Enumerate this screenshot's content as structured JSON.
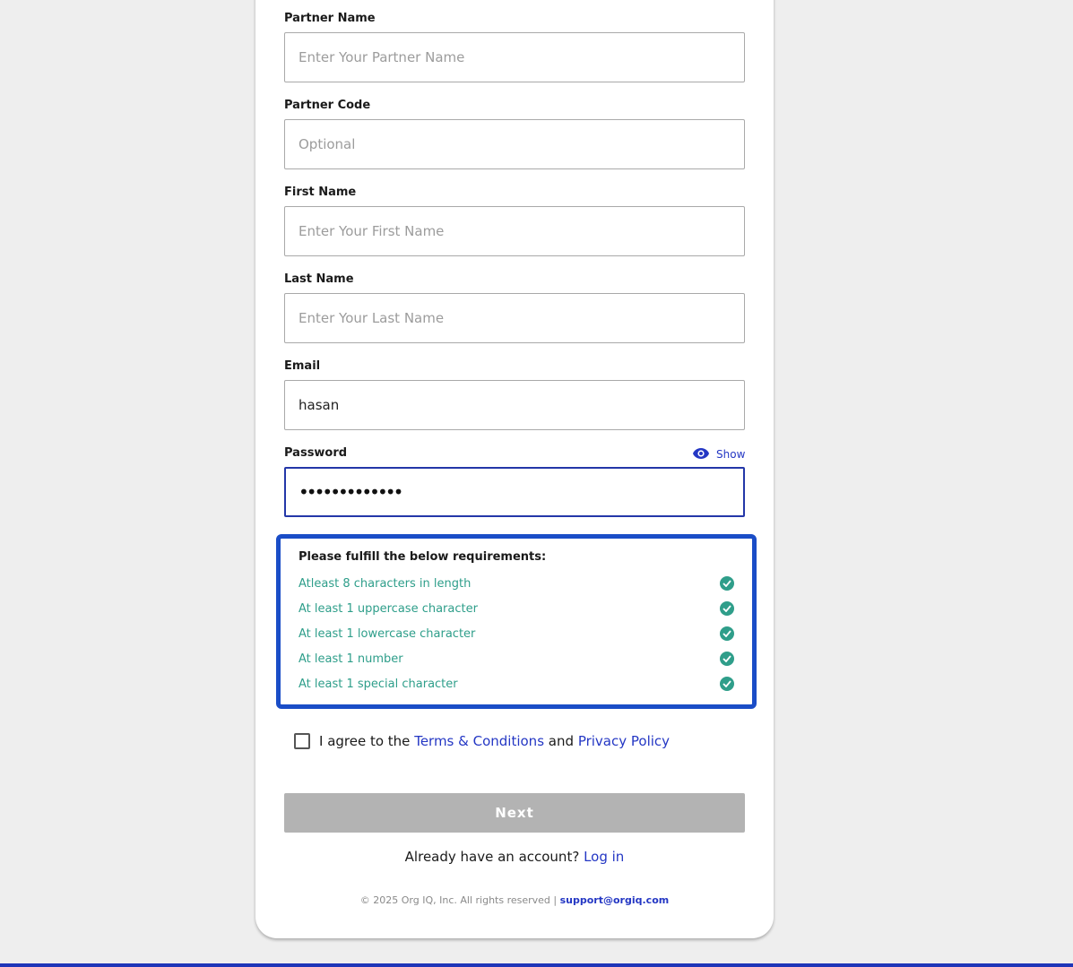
{
  "form": {
    "partner_name": {
      "label": "Partner Name",
      "placeholder": "Enter Your Partner Name",
      "value": ""
    },
    "partner_code": {
      "label": "Partner Code",
      "placeholder": "Optional",
      "value": ""
    },
    "first_name": {
      "label": "First Name",
      "placeholder": "Enter Your First Name",
      "value": ""
    },
    "last_name": {
      "label": "Last Name",
      "placeholder": "Enter Your Last Name",
      "value": ""
    },
    "email": {
      "label": "Email",
      "placeholder": "",
      "value": "hasan"
    },
    "password": {
      "label": "Password",
      "value": "•••••••••••••",
      "show_label": "Show"
    }
  },
  "requirements": {
    "title": "Please fulfill the below requirements:",
    "items": [
      {
        "text": "Atleast 8 characters in length",
        "met": true
      },
      {
        "text": "At least 1 uppercase character",
        "met": true
      },
      {
        "text": "At least 1 lowercase character",
        "met": true
      },
      {
        "text": "At least 1 number",
        "met": true
      },
      {
        "text": "At least 1 special character",
        "met": true
      }
    ],
    "met_color": "#2f9e8a"
  },
  "agreement": {
    "prefix": "I agree to the",
    "terms_link": "Terms & Conditions",
    "conjunction": "and",
    "privacy_link": "Privacy Policy",
    "checked": false
  },
  "actions": {
    "next_label": "Next",
    "have_account_text": "Already have an account?",
    "login_link": "Log in"
  },
  "footer": {
    "copyright": "© 2025 Org IQ, Inc. All rights reserved |",
    "support_email": "support@orgiq.com"
  },
  "colors": {
    "accent": "#2437c4",
    "highlight_border": "#1a4dc7",
    "disabled_button": "#b3b3b3"
  }
}
